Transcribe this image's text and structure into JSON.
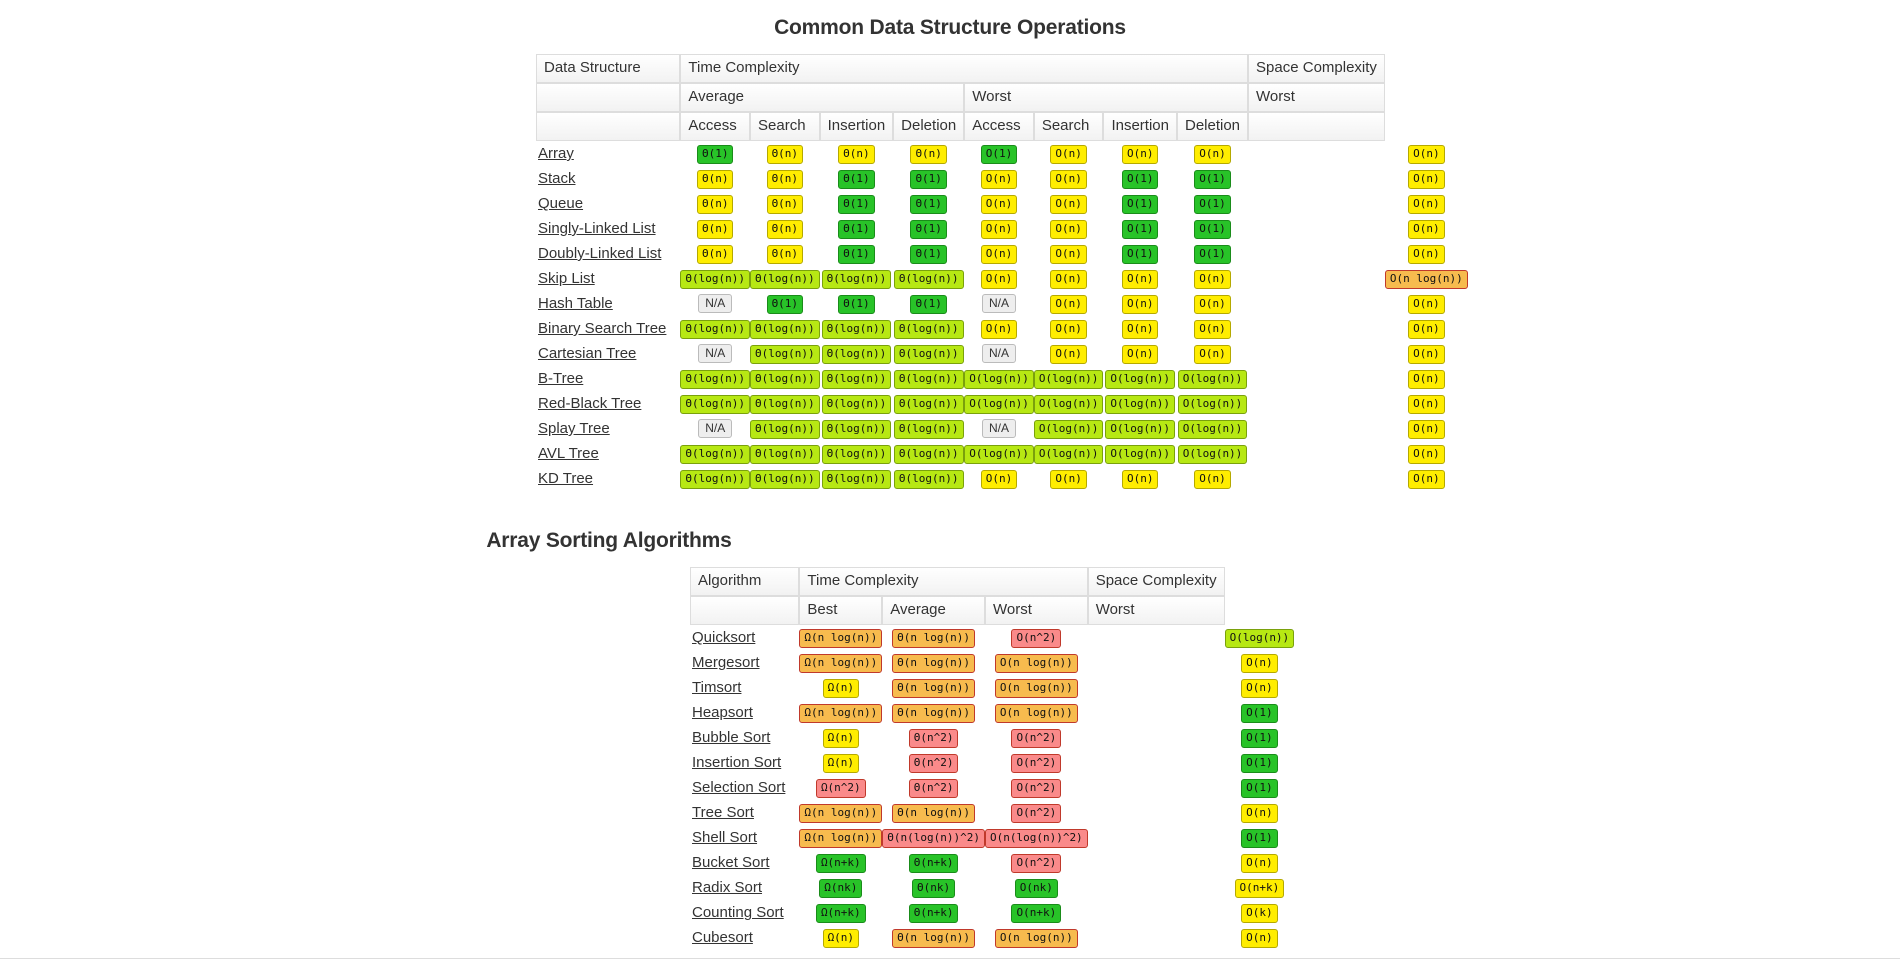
{
  "sections": {
    "ds_title": "Common Data Structure Operations",
    "sorting_title": "Array Sorting Algorithms"
  },
  "colors": {
    "green": "#28c328",
    "light_green": "#b7e813",
    "yellow": "#ffed00",
    "orange": "#f7bb4e",
    "red": "#fa8a8a",
    "na_gray": "#eeeeee"
  },
  "ds_table": {
    "headers": {
      "row1": [
        "Data Structure",
        "Time Complexity",
        "Space Complexity"
      ],
      "row2": [
        "",
        "Average",
        "Worst",
        "Worst"
      ],
      "row3": [
        "",
        "Access",
        "Search",
        "Insertion",
        "Deletion",
        "Access",
        "Search",
        "Insertion",
        "Deletion",
        ""
      ]
    },
    "rows": [
      {
        "name": "Array",
        "cells": [
          {
            "t": "Θ(1)",
            "c": "green"
          },
          {
            "t": "Θ(n)",
            "c": "yellow"
          },
          {
            "t": "Θ(n)",
            "c": "yellow"
          },
          {
            "t": "Θ(n)",
            "c": "yellow"
          },
          {
            "t": "O(1)",
            "c": "green"
          },
          {
            "t": "O(n)",
            "c": "yellow"
          },
          {
            "t": "O(n)",
            "c": "yellow"
          },
          {
            "t": "O(n)",
            "c": "yellow"
          },
          {
            "t": "O(n)",
            "c": "yellow"
          }
        ]
      },
      {
        "name": "Stack",
        "cells": [
          {
            "t": "Θ(n)",
            "c": "yellow"
          },
          {
            "t": "Θ(n)",
            "c": "yellow"
          },
          {
            "t": "Θ(1)",
            "c": "green"
          },
          {
            "t": "Θ(1)",
            "c": "green"
          },
          {
            "t": "O(n)",
            "c": "yellow"
          },
          {
            "t": "O(n)",
            "c": "yellow"
          },
          {
            "t": "O(1)",
            "c": "green"
          },
          {
            "t": "O(1)",
            "c": "green"
          },
          {
            "t": "O(n)",
            "c": "yellow"
          }
        ]
      },
      {
        "name": "Queue",
        "cells": [
          {
            "t": "Θ(n)",
            "c": "yellow"
          },
          {
            "t": "Θ(n)",
            "c": "yellow"
          },
          {
            "t": "Θ(1)",
            "c": "green"
          },
          {
            "t": "Θ(1)",
            "c": "green"
          },
          {
            "t": "O(n)",
            "c": "yellow"
          },
          {
            "t": "O(n)",
            "c": "yellow"
          },
          {
            "t": "O(1)",
            "c": "green"
          },
          {
            "t": "O(1)",
            "c": "green"
          },
          {
            "t": "O(n)",
            "c": "yellow"
          }
        ]
      },
      {
        "name": "Singly-Linked List",
        "cells": [
          {
            "t": "Θ(n)",
            "c": "yellow"
          },
          {
            "t": "Θ(n)",
            "c": "yellow"
          },
          {
            "t": "Θ(1)",
            "c": "green"
          },
          {
            "t": "Θ(1)",
            "c": "green"
          },
          {
            "t": "O(n)",
            "c": "yellow"
          },
          {
            "t": "O(n)",
            "c": "yellow"
          },
          {
            "t": "O(1)",
            "c": "green"
          },
          {
            "t": "O(1)",
            "c": "green"
          },
          {
            "t": "O(n)",
            "c": "yellow"
          }
        ]
      },
      {
        "name": "Doubly-Linked List",
        "cells": [
          {
            "t": "Θ(n)",
            "c": "yellow"
          },
          {
            "t": "Θ(n)",
            "c": "yellow"
          },
          {
            "t": "Θ(1)",
            "c": "green"
          },
          {
            "t": "Θ(1)",
            "c": "green"
          },
          {
            "t": "O(n)",
            "c": "yellow"
          },
          {
            "t": "O(n)",
            "c": "yellow"
          },
          {
            "t": "O(1)",
            "c": "green"
          },
          {
            "t": "O(1)",
            "c": "green"
          },
          {
            "t": "O(n)",
            "c": "yellow"
          }
        ]
      },
      {
        "name": "Skip List",
        "cells": [
          {
            "t": "Θ(log(n))",
            "c": "lgreen"
          },
          {
            "t": "Θ(log(n))",
            "c": "lgreen"
          },
          {
            "t": "Θ(log(n))",
            "c": "lgreen"
          },
          {
            "t": "Θ(log(n))",
            "c": "lgreen"
          },
          {
            "t": "O(n)",
            "c": "yellow"
          },
          {
            "t": "O(n)",
            "c": "yellow"
          },
          {
            "t": "O(n)",
            "c": "yellow"
          },
          {
            "t": "O(n)",
            "c": "yellow"
          },
          {
            "t": "O(n log(n))",
            "c": "orange"
          }
        ]
      },
      {
        "name": "Hash Table",
        "cells": [
          {
            "t": "N/A",
            "c": "na"
          },
          {
            "t": "Θ(1)",
            "c": "green"
          },
          {
            "t": "Θ(1)",
            "c": "green"
          },
          {
            "t": "Θ(1)",
            "c": "green"
          },
          {
            "t": "N/A",
            "c": "na"
          },
          {
            "t": "O(n)",
            "c": "yellow"
          },
          {
            "t": "O(n)",
            "c": "yellow"
          },
          {
            "t": "O(n)",
            "c": "yellow"
          },
          {
            "t": "O(n)",
            "c": "yellow"
          }
        ]
      },
      {
        "name": "Binary Search Tree",
        "cells": [
          {
            "t": "Θ(log(n))",
            "c": "lgreen"
          },
          {
            "t": "Θ(log(n))",
            "c": "lgreen"
          },
          {
            "t": "Θ(log(n))",
            "c": "lgreen"
          },
          {
            "t": "Θ(log(n))",
            "c": "lgreen"
          },
          {
            "t": "O(n)",
            "c": "yellow"
          },
          {
            "t": "O(n)",
            "c": "yellow"
          },
          {
            "t": "O(n)",
            "c": "yellow"
          },
          {
            "t": "O(n)",
            "c": "yellow"
          },
          {
            "t": "O(n)",
            "c": "yellow"
          }
        ]
      },
      {
        "name": "Cartesian Tree",
        "cells": [
          {
            "t": "N/A",
            "c": "na"
          },
          {
            "t": "Θ(log(n))",
            "c": "lgreen"
          },
          {
            "t": "Θ(log(n))",
            "c": "lgreen"
          },
          {
            "t": "Θ(log(n))",
            "c": "lgreen"
          },
          {
            "t": "N/A",
            "c": "na"
          },
          {
            "t": "O(n)",
            "c": "yellow"
          },
          {
            "t": "O(n)",
            "c": "yellow"
          },
          {
            "t": "O(n)",
            "c": "yellow"
          },
          {
            "t": "O(n)",
            "c": "yellow"
          }
        ]
      },
      {
        "name": "B-Tree",
        "cells": [
          {
            "t": "Θ(log(n))",
            "c": "lgreen"
          },
          {
            "t": "Θ(log(n))",
            "c": "lgreen"
          },
          {
            "t": "Θ(log(n))",
            "c": "lgreen"
          },
          {
            "t": "Θ(log(n))",
            "c": "lgreen"
          },
          {
            "t": "O(log(n))",
            "c": "lgreen"
          },
          {
            "t": "O(log(n))",
            "c": "lgreen"
          },
          {
            "t": "O(log(n))",
            "c": "lgreen"
          },
          {
            "t": "O(log(n))",
            "c": "lgreen"
          },
          {
            "t": "O(n)",
            "c": "yellow"
          }
        ]
      },
      {
        "name": "Red-Black Tree",
        "cells": [
          {
            "t": "Θ(log(n))",
            "c": "lgreen"
          },
          {
            "t": "Θ(log(n))",
            "c": "lgreen"
          },
          {
            "t": "Θ(log(n))",
            "c": "lgreen"
          },
          {
            "t": "Θ(log(n))",
            "c": "lgreen"
          },
          {
            "t": "O(log(n))",
            "c": "lgreen"
          },
          {
            "t": "O(log(n))",
            "c": "lgreen"
          },
          {
            "t": "O(log(n))",
            "c": "lgreen"
          },
          {
            "t": "O(log(n))",
            "c": "lgreen"
          },
          {
            "t": "O(n)",
            "c": "yellow"
          }
        ]
      },
      {
        "name": "Splay Tree",
        "cells": [
          {
            "t": "N/A",
            "c": "na"
          },
          {
            "t": "Θ(log(n))",
            "c": "lgreen"
          },
          {
            "t": "Θ(log(n))",
            "c": "lgreen"
          },
          {
            "t": "Θ(log(n))",
            "c": "lgreen"
          },
          {
            "t": "N/A",
            "c": "na"
          },
          {
            "t": "O(log(n))",
            "c": "lgreen"
          },
          {
            "t": "O(log(n))",
            "c": "lgreen"
          },
          {
            "t": "O(log(n))",
            "c": "lgreen"
          },
          {
            "t": "O(n)",
            "c": "yellow"
          }
        ]
      },
      {
        "name": "AVL Tree",
        "cells": [
          {
            "t": "Θ(log(n))",
            "c": "lgreen"
          },
          {
            "t": "Θ(log(n))",
            "c": "lgreen"
          },
          {
            "t": "Θ(log(n))",
            "c": "lgreen"
          },
          {
            "t": "Θ(log(n))",
            "c": "lgreen"
          },
          {
            "t": "O(log(n))",
            "c": "lgreen"
          },
          {
            "t": "O(log(n))",
            "c": "lgreen"
          },
          {
            "t": "O(log(n))",
            "c": "lgreen"
          },
          {
            "t": "O(log(n))",
            "c": "lgreen"
          },
          {
            "t": "O(n)",
            "c": "yellow"
          }
        ]
      },
      {
        "name": "KD Tree",
        "cells": [
          {
            "t": "Θ(log(n))",
            "c": "lgreen"
          },
          {
            "t": "Θ(log(n))",
            "c": "lgreen"
          },
          {
            "t": "Θ(log(n))",
            "c": "lgreen"
          },
          {
            "t": "Θ(log(n))",
            "c": "lgreen"
          },
          {
            "t": "O(n)",
            "c": "yellow"
          },
          {
            "t": "O(n)",
            "c": "yellow"
          },
          {
            "t": "O(n)",
            "c": "yellow"
          },
          {
            "t": "O(n)",
            "c": "yellow"
          },
          {
            "t": "O(n)",
            "c": "yellow"
          }
        ]
      }
    ]
  },
  "sorting_table": {
    "headers": {
      "row1": [
        "Algorithm",
        "Time Complexity",
        "Space Complexity"
      ],
      "row2": [
        "",
        "Best",
        "Average",
        "Worst",
        "Worst"
      ]
    },
    "rows": [
      {
        "name": "Quicksort",
        "cells": [
          {
            "t": "Ω(n log(n))",
            "c": "orange"
          },
          {
            "t": "Θ(n log(n))",
            "c": "orange"
          },
          {
            "t": "O(n^2)",
            "c": "red"
          },
          {
            "t": "O(log(n))",
            "c": "lgreen"
          }
        ]
      },
      {
        "name": "Mergesort",
        "cells": [
          {
            "t": "Ω(n log(n))",
            "c": "orange"
          },
          {
            "t": "Θ(n log(n))",
            "c": "orange"
          },
          {
            "t": "O(n log(n))",
            "c": "orange"
          },
          {
            "t": "O(n)",
            "c": "yellow"
          }
        ]
      },
      {
        "name": "Timsort",
        "cells": [
          {
            "t": "Ω(n)",
            "c": "yellow"
          },
          {
            "t": "Θ(n log(n))",
            "c": "orange"
          },
          {
            "t": "O(n log(n))",
            "c": "orange"
          },
          {
            "t": "O(n)",
            "c": "yellow"
          }
        ]
      },
      {
        "name": "Heapsort",
        "cells": [
          {
            "t": "Ω(n log(n))",
            "c": "orange"
          },
          {
            "t": "Θ(n log(n))",
            "c": "orange"
          },
          {
            "t": "O(n log(n))",
            "c": "orange"
          },
          {
            "t": "O(1)",
            "c": "green"
          }
        ]
      },
      {
        "name": "Bubble Sort",
        "cells": [
          {
            "t": "Ω(n)",
            "c": "yellow"
          },
          {
            "t": "Θ(n^2)",
            "c": "red"
          },
          {
            "t": "O(n^2)",
            "c": "red"
          },
          {
            "t": "O(1)",
            "c": "green"
          }
        ]
      },
      {
        "name": "Insertion Sort",
        "cells": [
          {
            "t": "Ω(n)",
            "c": "yellow"
          },
          {
            "t": "Θ(n^2)",
            "c": "red"
          },
          {
            "t": "O(n^2)",
            "c": "red"
          },
          {
            "t": "O(1)",
            "c": "green"
          }
        ]
      },
      {
        "name": "Selection Sort",
        "cells": [
          {
            "t": "Ω(n^2)",
            "c": "red"
          },
          {
            "t": "Θ(n^2)",
            "c": "red"
          },
          {
            "t": "O(n^2)",
            "c": "red"
          },
          {
            "t": "O(1)",
            "c": "green"
          }
        ]
      },
      {
        "name": "Tree Sort",
        "cells": [
          {
            "t": "Ω(n log(n))",
            "c": "orange"
          },
          {
            "t": "Θ(n log(n))",
            "c": "orange"
          },
          {
            "t": "O(n^2)",
            "c": "red"
          },
          {
            "t": "O(n)",
            "c": "yellow"
          }
        ]
      },
      {
        "name": "Shell Sort",
        "cells": [
          {
            "t": "Ω(n log(n))",
            "c": "orange"
          },
          {
            "t": "Θ(n(log(n))^2)",
            "c": "red"
          },
          {
            "t": "O(n(log(n))^2)",
            "c": "red"
          },
          {
            "t": "O(1)",
            "c": "green"
          }
        ]
      },
      {
        "name": "Bucket Sort",
        "cells": [
          {
            "t": "Ω(n+k)",
            "c": "green"
          },
          {
            "t": "Θ(n+k)",
            "c": "green"
          },
          {
            "t": "O(n^2)",
            "c": "red"
          },
          {
            "t": "O(n)",
            "c": "yellow"
          }
        ]
      },
      {
        "name": "Radix Sort",
        "cells": [
          {
            "t": "Ω(nk)",
            "c": "green"
          },
          {
            "t": "Θ(nk)",
            "c": "green"
          },
          {
            "t": "O(nk)",
            "c": "green"
          },
          {
            "t": "O(n+k)",
            "c": "yellow"
          }
        ]
      },
      {
        "name": "Counting Sort",
        "cells": [
          {
            "t": "Ω(n+k)",
            "c": "green"
          },
          {
            "t": "Θ(n+k)",
            "c": "green"
          },
          {
            "t": "O(n+k)",
            "c": "green"
          },
          {
            "t": "O(k)",
            "c": "yellow"
          }
        ]
      },
      {
        "name": "Cubesort",
        "cells": [
          {
            "t": "Ω(n)",
            "c": "yellow"
          },
          {
            "t": "Θ(n log(n))",
            "c": "orange"
          },
          {
            "t": "O(n log(n))",
            "c": "orange"
          },
          {
            "t": "O(n)",
            "c": "yellow"
          }
        ]
      }
    ]
  }
}
